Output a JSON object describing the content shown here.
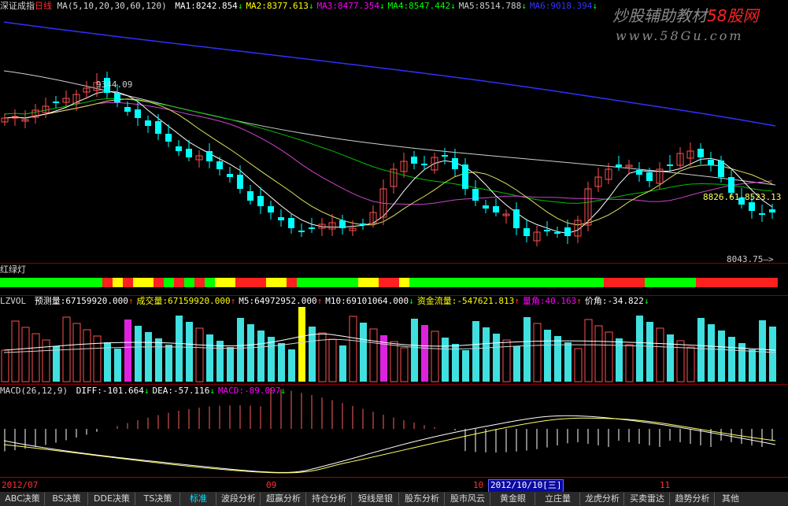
{
  "header": {
    "title": "深证成指",
    "period": "日线",
    "ma_params": "MA(5,10,20,30,60,120)",
    "ma": [
      {
        "label": "MA1:",
        "value": "8242.854",
        "arrow": "↓",
        "color": "#ffffff"
      },
      {
        "label": "MA2:",
        "value": "8377.613",
        "arrow": "↓",
        "color": "#ffff00"
      },
      {
        "label": "MA3:",
        "value": "8477.354",
        "arrow": "↓",
        "color": "#ff00ff"
      },
      {
        "label": "MA4:",
        "value": "8547.442",
        "arrow": "↓",
        "color": "#00ff00"
      },
      {
        "label": "MA5:",
        "value": "8514.788",
        "arrow": "↓",
        "color": "#cccccc"
      },
      {
        "label": "MA6:",
        "value": "9018.394",
        "arrow": "↓",
        "color": "#3333ff"
      }
    ]
  },
  "watermark": {
    "line1": "炒股辅助教材",
    "brand": "58股网",
    "line2": "www.58Gu.com"
  },
  "price_labels": {
    "high": "9344.09",
    "mid": "8826.61-8523.13",
    "low": "8043.75"
  },
  "signal": {
    "title": "红绿灯"
  },
  "volume": {
    "name": "LZVOL",
    "items": [
      {
        "label": "预测量:",
        "value": "67159920.000",
        "arrow": "↑",
        "color": "#ffffff"
      },
      {
        "label": "成交量:",
        "value": "67159920.000",
        "arrow": "↑",
        "color": "#ffff00"
      },
      {
        "label": "M5:",
        "value": "64972952.000",
        "arrow": "↑",
        "color": "#ffffff"
      },
      {
        "label": "M10:",
        "value": "69101064.000",
        "arrow": "↓",
        "color": "#ffffff"
      },
      {
        "label": "资金流量:",
        "value": "-547621.813",
        "arrow": "↑",
        "color": "#ffff00"
      },
      {
        "label": "量角:",
        "value": "40.163",
        "arrow": "↑",
        "color": "#ff00ff"
      },
      {
        "label": "价角:",
        "value": "-34.822",
        "arrow": "↓",
        "color": "#ffffff"
      }
    ]
  },
  "macd": {
    "params": "MACD(26,12,9)",
    "items": [
      {
        "label": "DIFF:",
        "value": "-101.664",
        "arrow": "↓",
        "color": "#ffffff"
      },
      {
        "label": "DEA:",
        "value": "-57.116",
        "arrow": "↓",
        "color": "#ffffff"
      },
      {
        "label": "MACD:",
        "value": "-89.097",
        "arrow": "↓",
        "color": "#ff00ff"
      }
    ]
  },
  "timeline": {
    "start": "2012/07",
    "m9": "09",
    "m10": "10",
    "cursor": "2012/10/10",
    "weekday": "三",
    "m11": "11"
  },
  "tabs": [
    "ABC决策",
    "BS决策",
    "DDE决策",
    "TS决策",
    "标准",
    "波段分析",
    "超赢分析",
    "持仓分析",
    "短线是银",
    "股东分析",
    "股市风云",
    "黄金眼",
    "立庄量",
    "龙虎分析",
    "买卖雷达",
    "趋势分析",
    "其他"
  ],
  "active_tab": "标准"
}
